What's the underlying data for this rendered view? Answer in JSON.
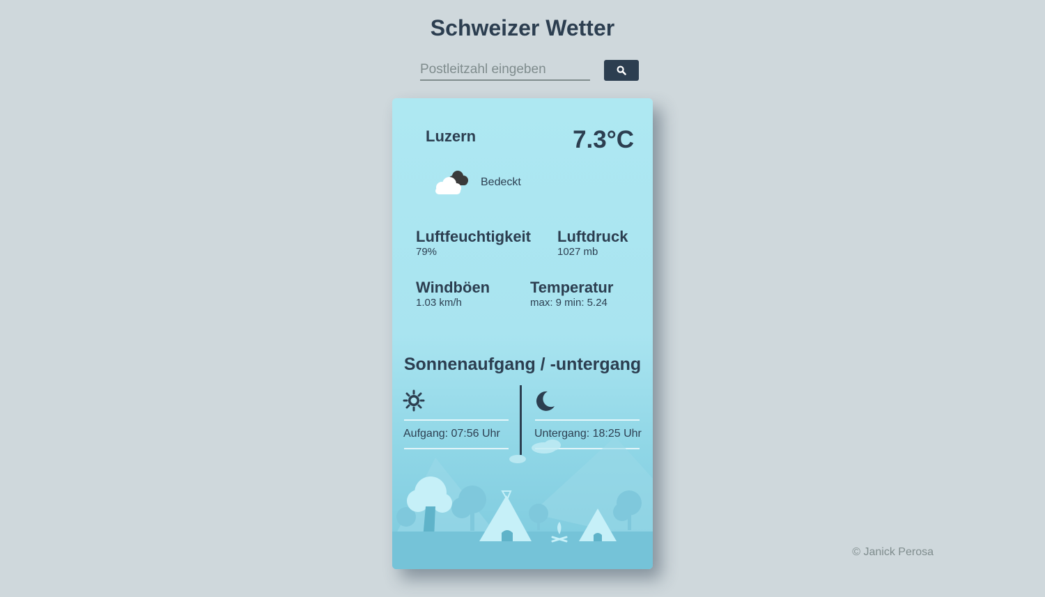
{
  "header": {
    "title": "Schweizer Wetter"
  },
  "search": {
    "placeholder": "Postleitzahl eingeben",
    "button_icon": "search-icon"
  },
  "weather": {
    "city": "Luzern",
    "temperature": "7.3°C",
    "condition": "Bedeckt",
    "condition_icon": "cloud-icon",
    "stats": {
      "humidity": {
        "label": "Luftfeuchtigkeit",
        "value": "79%"
      },
      "pressure": {
        "label": "Luftdruck",
        "value": "1027 mb"
      },
      "gusts": {
        "label": "Windböen",
        "value": "1.03 km/h"
      },
      "temperature_range": {
        "label": "Temperatur",
        "value": "max: 9 min: 5.24"
      }
    }
  },
  "sun": {
    "title": "Sonnenaufgang / -untergang",
    "sunrise": "Aufgang: 07:56 Uhr",
    "sunset": "Untergang: 18:25 Uhr",
    "sunrise_icon": "sun-icon",
    "sunset_icon": "moon-icon"
  },
  "footer": {
    "copyright": "© Janick Perosa"
  },
  "colors": {
    "background": "#cfd8dc",
    "primary_text": "#2c3e50",
    "card_top": "#aee8f2",
    "card_bottom": "#7cc9dd",
    "button": "#2c3e50"
  }
}
